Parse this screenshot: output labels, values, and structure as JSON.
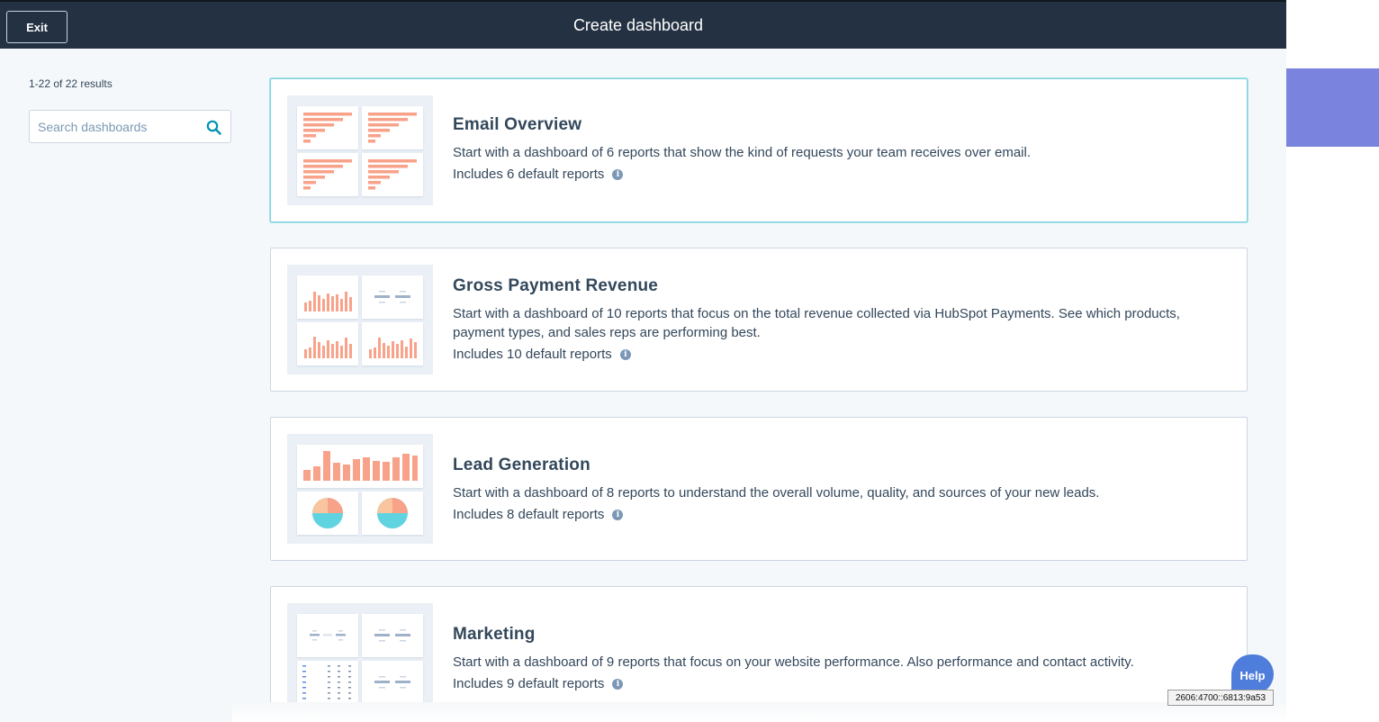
{
  "header": {
    "exit_label": "Exit",
    "title": "Create dashboard"
  },
  "sidebar": {
    "results_text": "1-22 of 22 results",
    "search_placeholder": "Search dashboards",
    "search_value": ""
  },
  "cards": [
    {
      "title": "Email Overview",
      "description": "Start with a dashboard of 6 reports that show the kind of requests your team receives over email.",
      "includes": "Includes 6 default reports",
      "selected": true,
      "thumbnail": "bar-charts"
    },
    {
      "title": "Gross Payment Revenue",
      "description": "Start with a dashboard of 10 reports that focus on the total revenue collected via HubSpot Payments. See which products, payment types, and sales reps are performing best.",
      "includes": "Includes 10 default reports",
      "selected": false,
      "thumbnail": "column-charts"
    },
    {
      "title": "Lead Generation",
      "description": "Start with a dashboard of 8 reports to understand the overall volume, quality, and sources of your new leads.",
      "includes": "Includes 8 default reports",
      "selected": false,
      "thumbnail": "column-and-pie-charts"
    },
    {
      "title": "Marketing",
      "description": "Start with a dashboard of 9 reports that focus on your website performance. Also performance and contact activity.",
      "includes": "Includes 9 default reports",
      "selected": false,
      "thumbnail": "kpi-and-table"
    }
  ],
  "help": {
    "label": "Help"
  },
  "tooltip": {
    "ip_text": "2606:4700::6813:9a53"
  },
  "colors": {
    "header_bg": "#243142",
    "accent_selected_border": "#7fd1de",
    "chart_orange": "#f8a28a",
    "pie_teal": "#5fd3e0",
    "pie_peach": "#f9c59e",
    "side_purple": "#7a83dd",
    "help_blue": "#4f7ddb"
  }
}
